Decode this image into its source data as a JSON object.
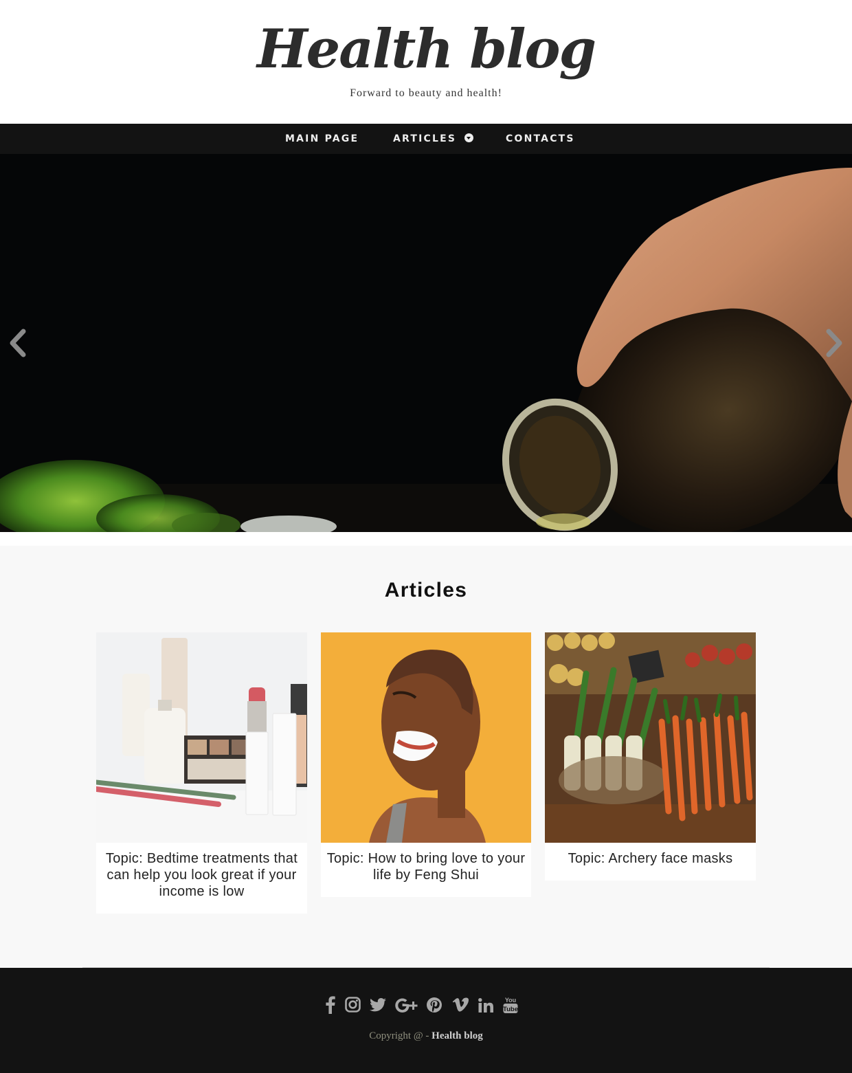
{
  "header": {
    "title": "Health blog",
    "tagline": "Forward to beauty and health!"
  },
  "nav": {
    "items": [
      {
        "label": "MAIN PAGE"
      },
      {
        "label": "ARTICLES"
      },
      {
        "label": "CONTACTS"
      }
    ]
  },
  "hero": {
    "image_description": "hand pouring oil from a glass bottle against a dark background",
    "prev_icon": "chevron-left-icon",
    "next_icon": "chevron-right-icon"
  },
  "articles": {
    "heading": "Articles",
    "items": [
      {
        "title": "Topic: Bedtime treatments that can help you look great if your income is low"
      },
      {
        "title": "Topic: How to bring love to your life by Feng Shui"
      },
      {
        "title": "Topic: Archery face masks"
      }
    ]
  },
  "footer": {
    "social_icons": [
      "facebook-icon",
      "instagram-icon",
      "twitter-icon",
      "google-plus-icon",
      "pinterest-icon",
      "vimeo-icon",
      "linkedin-icon",
      "youtube-icon"
    ],
    "copyright_prefix": "Copyright @ - ",
    "copyright_brand": "Health blog"
  },
  "colors": {
    "nav_background": "#131313",
    "footer_background": "#131313",
    "section_background": "#f8f8f8",
    "icon_color": "#a8a8a8"
  }
}
